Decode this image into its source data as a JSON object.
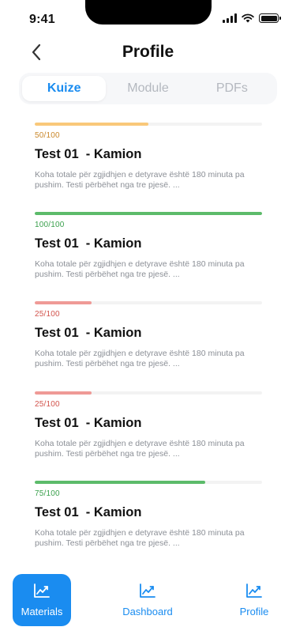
{
  "status_bar": {
    "time": "9:41"
  },
  "header": {
    "title": "Profile",
    "back_icon": "chevron-left-icon"
  },
  "tabs": [
    {
      "label": "Kuize",
      "active": true
    },
    {
      "label": "Module",
      "active": false
    },
    {
      "label": "PDFs",
      "active": false
    }
  ],
  "quizzes": [
    {
      "score": "50/100",
      "progress": 0.5,
      "color": "#f9c87a",
      "score_color": "#c9872a",
      "title": "Test 01  - Kamion",
      "description": "Koha totale për zgjidhjen e detyrave është 180 minuta pa pushim. Testi përbëhet nga tre pjesë.  ..."
    },
    {
      "score": "100/100",
      "progress": 1.0,
      "color": "#5cbb6a",
      "score_color": "#3aa04c",
      "title": "Test 01  - Kamion",
      "description": "Koha totale për zgjidhjen e detyrave është 180 minuta pa pushim. Testi përbëhet nga tre pjesë.  ..."
    },
    {
      "score": "25/100",
      "progress": 0.25,
      "color": "#ef9a96",
      "score_color": "#d2534c",
      "title": "Test 01  - Kamion",
      "description": "Koha totale për zgjidhjen e detyrave është 180 minuta pa pushim. Testi përbëhet nga tre pjesë.  ..."
    },
    {
      "score": "25/100",
      "progress": 0.25,
      "color": "#ef9a96",
      "score_color": "#d2534c",
      "title": "Test 01  - Kamion",
      "description": "Koha totale për zgjidhjen e detyrave është 180 minuta pa pushim. Testi përbëhet nga tre pjesë.  ..."
    },
    {
      "score": "75/100",
      "progress": 0.75,
      "color": "#5cbb6a",
      "score_color": "#3aa04c",
      "title": "Test 01  - Kamion",
      "description": "Koha totale për zgjidhjen e detyrave është 180 minuta pa pushim. Testi përbëhet nga tre pjesë.  ..."
    }
  ],
  "bottom_nav": [
    {
      "label": "Materials",
      "icon": "chart-icon",
      "active": true
    },
    {
      "label": "Dashboard",
      "icon": "chart-icon",
      "active": false
    },
    {
      "label": "Profile",
      "icon": "chart-icon",
      "active": false
    }
  ],
  "colors": {
    "accent": "#1a8cf0"
  }
}
